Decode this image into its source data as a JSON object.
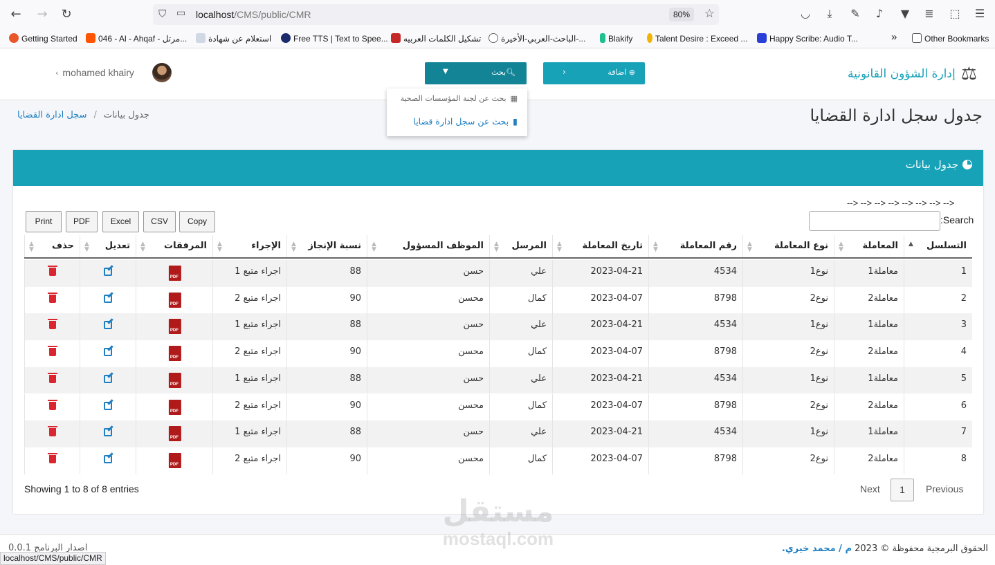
{
  "browser": {
    "url_host": "localhost",
    "url_path": "/CMS/public/CMR",
    "zoom": "80%",
    "status_url": "localhost/CMS/public/CMR",
    "bookmarks": [
      {
        "label": "Getting Started",
        "color": "#e8562a"
      },
      {
        "label": "046 - Al - Ahqaf - مرتل...",
        "color": "#ff5500"
      },
      {
        "label": "استعلام عن شهادة",
        "color": "#cfd8e3"
      },
      {
        "label": "Free TTS | Text to Spee...",
        "color": "#1b2a6b"
      },
      {
        "label": "تشكيل الكلمات العربيه",
        "color": "#c62828"
      },
      {
        "label": "الباحث-العربي-الأخيرة-...",
        "color": "#888888"
      },
      {
        "label": "Blakify",
        "color": "#1fbf8f"
      },
      {
        "label": "Talent Desire : Exceed ...",
        "color": "#f0b400"
      },
      {
        "label": "Happy Scribe: Audio T...",
        "color": "#2a3fd6"
      }
    ],
    "other_bookmarks": "Other Bookmarks",
    "overflow_chevron": "»"
  },
  "header": {
    "brand": "إدارة الشؤون القانونية",
    "add_label": "اضافة",
    "search_label": "بحث",
    "user_name": "mohamed khairy"
  },
  "dropdown": {
    "items": [
      {
        "label": "بحث عن لجنة المؤسسات الصحية",
        "icon": "building-icon"
      },
      {
        "label": "بحث عن سجل ادارة قضايا",
        "icon": "file-icon"
      }
    ]
  },
  "page": {
    "title": "جدول سجل ادارة القضايا",
    "breadcrumb": {
      "link": "سجل ادارة القضايا",
      "separator": "/",
      "current": "جدول بيانات"
    }
  },
  "card": {
    "title": "جدول بيانات",
    "arrows": "--> --> --> --> --> --> --> -->",
    "search_label": ":Search",
    "buttons": [
      "Copy",
      "CSV",
      "Excel",
      "PDF",
      "Print"
    ]
  },
  "table": {
    "headers": [
      "التسلسل",
      "المعاملة",
      "نوع المعاملة",
      "رقم المعاملة",
      "تاريخ المعاملة",
      "المرسل",
      "الموظف المسؤول",
      "نسبة الإنجاز",
      "الإجراء",
      "المرفقات",
      "تعديل",
      "حذف"
    ],
    "rows": [
      [
        "1",
        "معاملة1",
        "نوع1",
        "4534",
        "2023-04-21",
        "علي",
        "حسن",
        "88",
        "اجراء متبع 1"
      ],
      [
        "2",
        "معاملة2",
        "نوع2",
        "8798",
        "2023-04-07",
        "كمال",
        "محسن",
        "90",
        "اجراء متبع 2"
      ],
      [
        "3",
        "معاملة1",
        "نوع1",
        "4534",
        "2023-04-21",
        "علي",
        "حسن",
        "88",
        "اجراء متبع 1"
      ],
      [
        "4",
        "معاملة2",
        "نوع2",
        "8798",
        "2023-04-07",
        "كمال",
        "محسن",
        "90",
        "اجراء متبع 2"
      ],
      [
        "5",
        "معاملة1",
        "نوع1",
        "4534",
        "2023-04-21",
        "علي",
        "حسن",
        "88",
        "اجراء متبع 1"
      ],
      [
        "6",
        "معاملة2",
        "نوع2",
        "8798",
        "2023-04-07",
        "كمال",
        "محسن",
        "90",
        "اجراء متبع 2"
      ],
      [
        "7",
        "معاملة1",
        "نوع1",
        "4534",
        "2023-04-21",
        "علي",
        "حسن",
        "88",
        "اجراء متبع 1"
      ],
      [
        "8",
        "معاملة2",
        "نوع2",
        "8798",
        "2023-04-07",
        "كمال",
        "محسن",
        "90",
        "اجراء متبع 2"
      ]
    ],
    "showing": "Showing 1 to 8 of 8 entries",
    "pagination": {
      "previous": "Previous",
      "page": "1",
      "next": "Next"
    }
  },
  "footer": {
    "copyright": "الحقوق البرمجية محفوظة © 2023",
    "author": "م / محمد خيري.",
    "version": "اصدار البرنامج 0.0.1"
  },
  "watermark": {
    "arabic": "مستقل",
    "latin": "mostaql.com"
  }
}
